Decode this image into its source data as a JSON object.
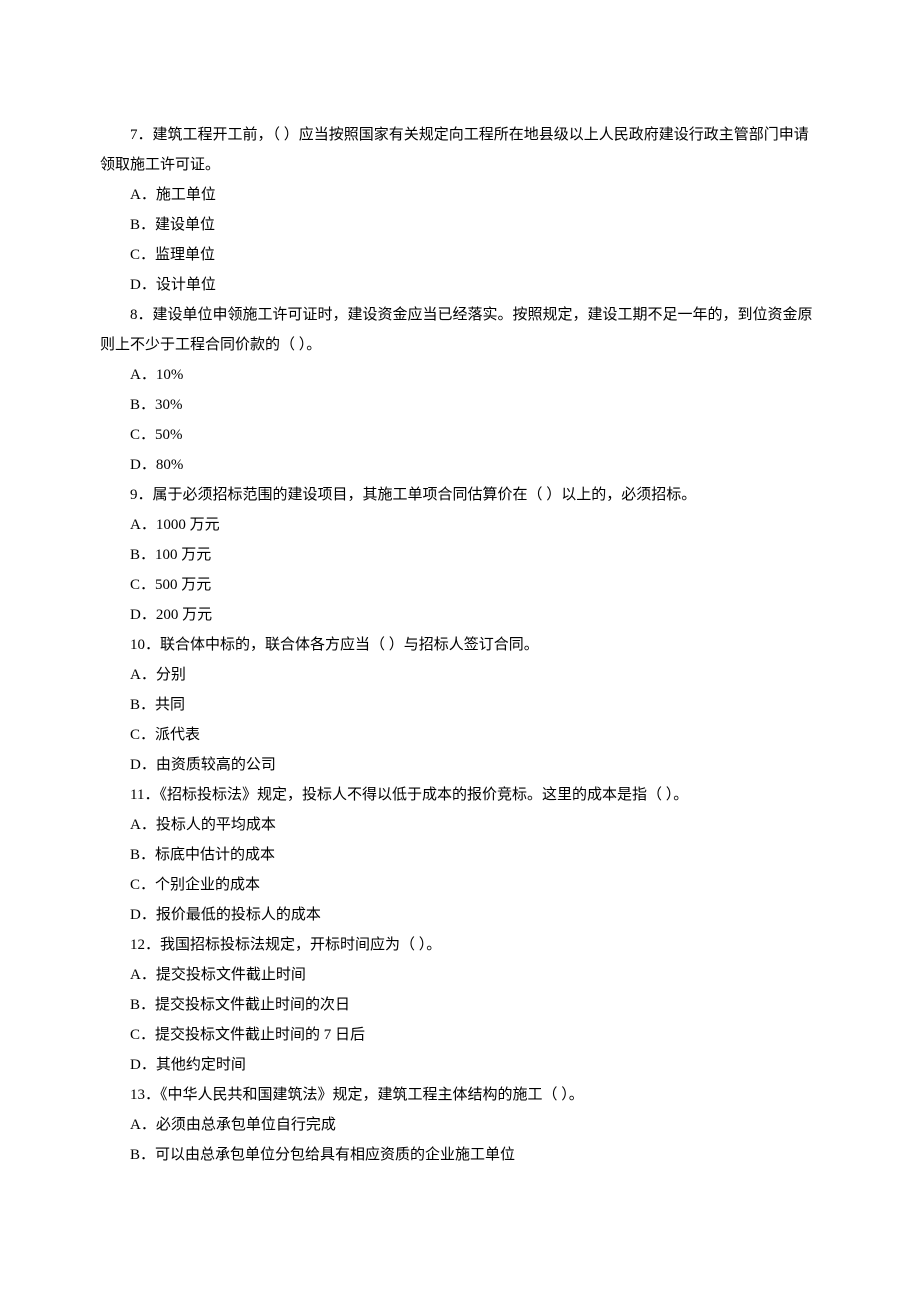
{
  "questions": [
    {
      "number": "7．",
      "text": "建筑工程开工前，（ ）应当按照国家有关规定向工程所在地县级以上人民政府建设行政主管部门申请领取施工许可证。",
      "continuation": "",
      "options": {
        "A": "A．施工单位",
        "B": "B．建设单位",
        "C": "C．监理单位",
        "D": "D．设计单位"
      }
    },
    {
      "number": "8．",
      "text": "建设单位申领施工许可证时，建设资金应当已经落实。按照规定，建设工期不足一年的，到位资金原则上不少于工程合同价款的（ ）。",
      "continuation": "",
      "options": {
        "A": "A．10%",
        "B": "B．30%",
        "C": "C．50%",
        "D": "D．80%"
      }
    },
    {
      "number": "9．",
      "text": "属于必须招标范围的建设项目，其施工单项合同估算价在（ ）以上的，必须招标。",
      "continuation": "",
      "options": {
        "A": "A．1000 万元",
        "B": "B．100 万元",
        "C": "C．500 万元",
        "D": "D．200 万元"
      }
    },
    {
      "number": "10．",
      "text": "联合体中标的，联合体各方应当（ ）与招标人签订合同。",
      "continuation": "",
      "options": {
        "A": "A．分别",
        "B": "B．共同",
        "C": "C．派代表",
        "D": "D．由资质较高的公司"
      }
    },
    {
      "number": "11．",
      "text": "《招标投标法》规定，投标人不得以低于成本的报价竞标。这里的成本是指（ ）。",
      "continuation": "",
      "options": {
        "A": "A．投标人的平均成本",
        "B": "B．标底中估计的成本",
        "C": "C．个别企业的成本",
        "D": "D．报价最低的投标人的成本"
      }
    },
    {
      "number": "12．",
      "text": "我国招标投标法规定，开标时间应为（ ）。",
      "continuation": "",
      "options": {
        "A": "A．提交投标文件截止时间",
        "B": "B．提交投标文件截止时间的次日",
        "C": "C．提交投标文件截止时间的 7 日后",
        "D": "D．其他约定时间"
      }
    },
    {
      "number": "13．",
      "text": "《中华人民共和国建筑法》规定，建筑工程主体结构的施工（ ）。",
      "continuation": "",
      "options": {
        "A": "A．必须由总承包单位自行完成",
        "B": "B．可以由总承包单位分包给具有相应资质的企业施工单位"
      }
    }
  ]
}
